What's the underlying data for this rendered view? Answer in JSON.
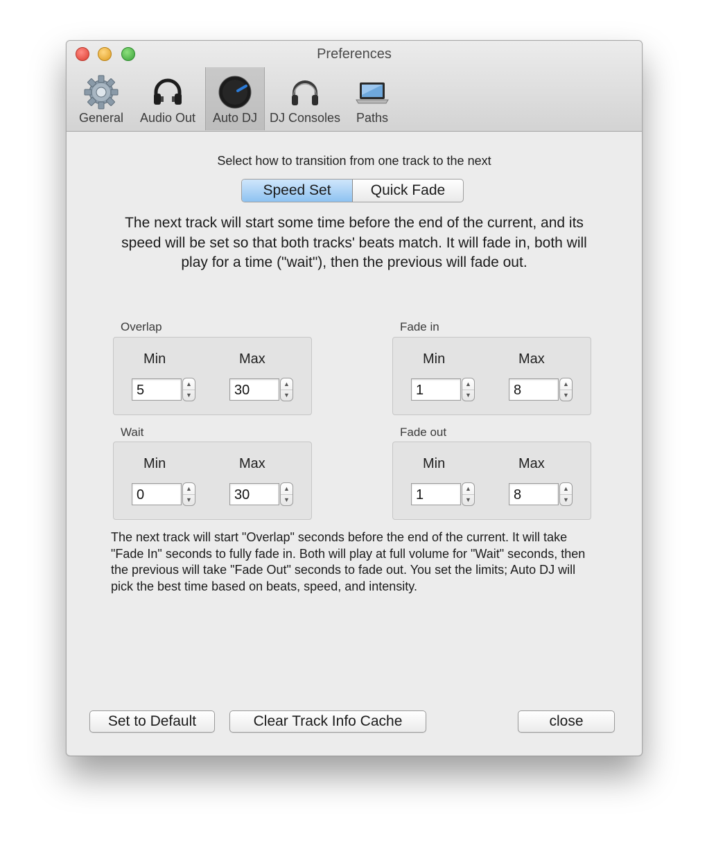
{
  "window": {
    "title": "Preferences",
    "traffic_lights": [
      "close",
      "minimize",
      "zoom"
    ]
  },
  "toolbar": {
    "items": [
      {
        "label": "General",
        "icon": "gear-icon"
      },
      {
        "label": "Audio Out",
        "icon": "headphones-icon"
      },
      {
        "label": "Auto DJ",
        "icon": "knob-icon",
        "selected": true
      },
      {
        "label": "DJ Consoles",
        "icon": "dj-headphones-icon"
      },
      {
        "label": "Paths",
        "icon": "laptop-icon"
      }
    ]
  },
  "transition": {
    "heading": "Select how to transition from one track to the next",
    "options": [
      "Speed Set",
      "Quick Fade"
    ],
    "selected": "Speed Set",
    "description": "The next track will start some time before the end of the current, and its speed will be set so that both tracks' beats match. It will fade in, both will play for a time (\"wait\"), then the previous will fade out."
  },
  "groups": {
    "overlap": {
      "label": "Overlap",
      "min_label": "Min",
      "max_label": "Max",
      "min": "5",
      "max": "30"
    },
    "fade_in": {
      "label": "Fade in",
      "min_label": "Min",
      "max_label": "Max",
      "min": "1",
      "max": "8"
    },
    "wait": {
      "label": "Wait",
      "min_label": "Min",
      "max_label": "Max",
      "min": "0",
      "max": "30"
    },
    "fade_out": {
      "label": "Fade out",
      "min_label": "Min",
      "max_label": "Max",
      "min": "1",
      "max": "8"
    }
  },
  "explanation": "The next track will start \"Overlap\" seconds before the end of the current. It will take \"Fade In\" seconds to fully fade in. Both will play at full volume for \"Wait\" seconds, then the previous will take \"Fade Out\" seconds to fade out. You set the limits; Auto DJ will pick the best time based on beats, speed, and intensity.",
  "buttons": {
    "default": "Set to Default",
    "clear_cache": "Clear Track Info Cache",
    "close": "close"
  },
  "colors": {
    "segment_active": "#8ec2f1",
    "window_bg": "#ececec",
    "close_light": "#dc3c30",
    "minimize_light": "#de9b1f",
    "zoom_light": "#3aa13a"
  }
}
